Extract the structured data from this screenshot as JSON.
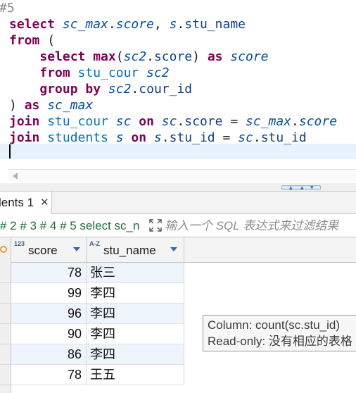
{
  "editor": {
    "ghost_prefix": "#",
    "lines": [
      [
        {
          "t": " 5",
          "c": "ghost"
        }
      ],
      [
        {
          "t": "select ",
          "c": "kw"
        },
        {
          "t": "sc_max",
          "c": "al"
        },
        {
          "t": ".",
          "c": ""
        },
        {
          "t": "score",
          "c": "al"
        },
        {
          "t": ", ",
          "c": ""
        },
        {
          "t": "s",
          "c": "al"
        },
        {
          "t": ".",
          "c": ""
        },
        {
          "t": "stu_name",
          "c": "cl"
        }
      ],
      [
        {
          "t": "from",
          "c": "kw"
        },
        {
          "t": " (",
          "c": ""
        }
      ],
      [
        {
          "t": "    ",
          "c": ""
        },
        {
          "t": "select ",
          "c": "kw"
        },
        {
          "t": "max",
          "c": "kw"
        },
        {
          "t": "(",
          "c": ""
        },
        {
          "t": "sc2",
          "c": "al"
        },
        {
          "t": ".",
          "c": ""
        },
        {
          "t": "score",
          "c": "cl"
        },
        {
          "t": ") ",
          "c": ""
        },
        {
          "t": "as ",
          "c": "kw"
        },
        {
          "t": "score",
          "c": "al"
        }
      ],
      [
        {
          "t": "    ",
          "c": ""
        },
        {
          "t": "from ",
          "c": "kw"
        },
        {
          "t": "stu_cour ",
          "c": "tb"
        },
        {
          "t": "sc2",
          "c": "al"
        }
      ],
      [
        {
          "t": "    ",
          "c": ""
        },
        {
          "t": "group by ",
          "c": "kw"
        },
        {
          "t": "sc2",
          "c": "al"
        },
        {
          "t": ".",
          "c": ""
        },
        {
          "t": "cour_id",
          "c": "cl"
        }
      ],
      [
        {
          "t": ") ",
          "c": ""
        },
        {
          "t": "as ",
          "c": "kw"
        },
        {
          "t": "sc_max",
          "c": "al"
        }
      ],
      [
        {
          "t": "join ",
          "c": "kw"
        },
        {
          "t": "stu_cour ",
          "c": "tb"
        },
        {
          "t": "sc ",
          "c": "al"
        },
        {
          "t": "on ",
          "c": "kw"
        },
        {
          "t": "sc",
          "c": "al"
        },
        {
          "t": ".",
          "c": ""
        },
        {
          "t": "score",
          "c": "cl"
        },
        {
          "t": " = ",
          "c": ""
        },
        {
          "t": "sc_max",
          "c": "al"
        },
        {
          "t": ".",
          "c": ""
        },
        {
          "t": "score",
          "c": "al"
        }
      ],
      [
        {
          "t": "join ",
          "c": "kw"
        },
        {
          "t": "students ",
          "c": "tb"
        },
        {
          "t": "s ",
          "c": "al"
        },
        {
          "t": "on ",
          "c": "kw"
        },
        {
          "t": "s",
          "c": "al"
        },
        {
          "t": ".",
          "c": ""
        },
        {
          "t": "stu_id",
          "c": "cl"
        },
        {
          "t": " = ",
          "c": ""
        },
        {
          "t": "sc",
          "c": "al"
        },
        {
          "t": ".",
          "c": ""
        },
        {
          "t": "stu_id",
          "c": "cl"
        }
      ]
    ]
  },
  "results": {
    "tab_label": "lents 1",
    "tab_close": "✕",
    "history": "# 2 # 3 # 4 # 5 select sc_n",
    "filter_placeholder": "输入一个 SQL 表达式来过滤结果",
    "columns": [
      {
        "tag": "123",
        "name": "score"
      },
      {
        "tag": "A-Z",
        "name": "stu_name"
      }
    ],
    "rows": [
      {
        "score": "78",
        "stu_name": "张三"
      },
      {
        "score": "99",
        "stu_name": "李四"
      },
      {
        "score": "96",
        "stu_name": "李四"
      },
      {
        "score": "90",
        "stu_name": "李四"
      },
      {
        "score": "86",
        "stu_name": "李四"
      },
      {
        "score": "78",
        "stu_name": "王五"
      }
    ]
  },
  "tooltip": {
    "line1": "Column: count(sc.stu_id)",
    "line2": "Read-only: 没有相应的表格"
  },
  "colors": {
    "keyword": "#7f0055",
    "alias": "#0050a0",
    "history": "#1f6f3a",
    "row_alt": "#eef4fc"
  }
}
